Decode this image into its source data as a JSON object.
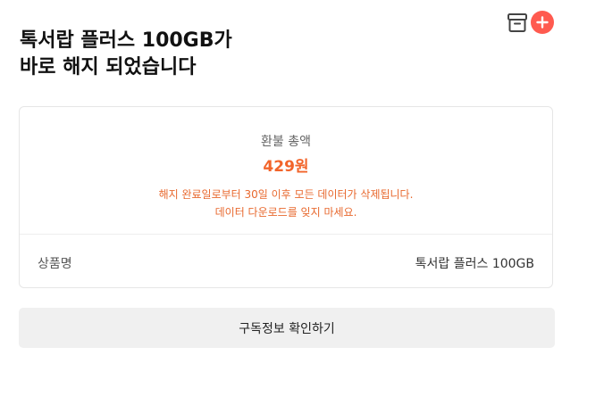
{
  "header": {
    "icons": {
      "box": "box-icon",
      "plus": "plus-icon"
    },
    "accent_color": "#ff5a4f"
  },
  "headline": {
    "line1": "톡서랍 플러스 100GB가",
    "line2": "바로 해지 되었습니다"
  },
  "refund": {
    "label": "환불 총액",
    "amount": "429원",
    "amount_color": "#f2642a",
    "notice_line1": "해지 완료일로부터 30일 이후 모든 데이터가 삭제됩니다.",
    "notice_line2": "데이터 다운로드를 잊지 마세요."
  },
  "product": {
    "label": "상품명",
    "value": "톡서랍 플러스 100GB"
  },
  "actions": {
    "confirm_label": "구독정보 확인하기"
  }
}
